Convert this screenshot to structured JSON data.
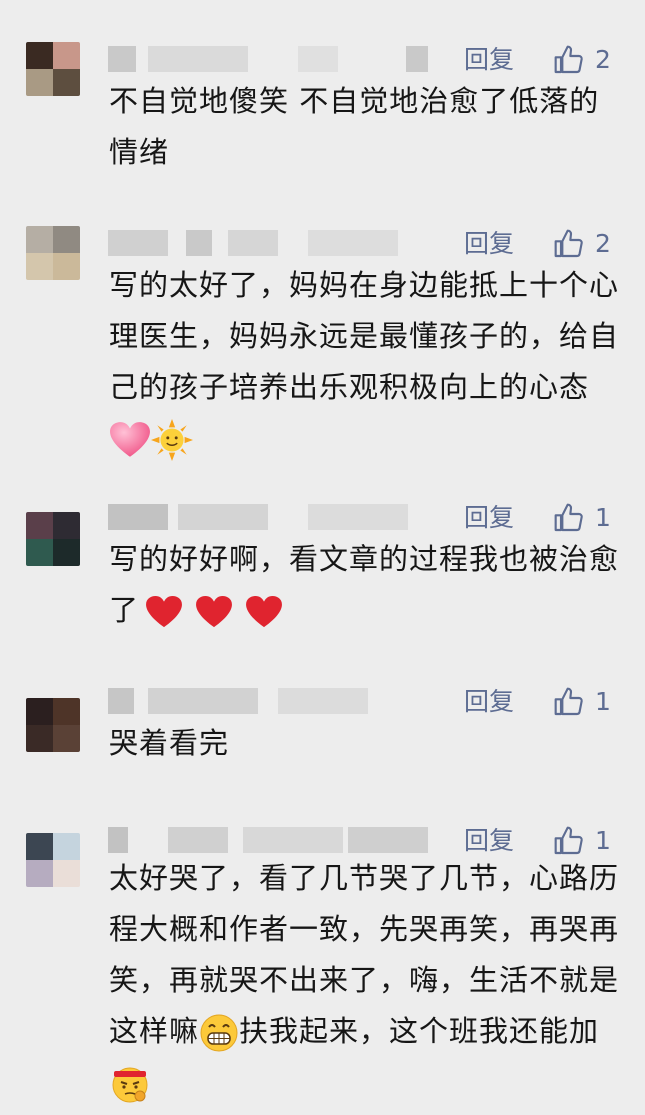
{
  "comments": [
    {
      "reply_label": "回复",
      "likes": "2",
      "text": "不自觉地傻笑 不自觉地治愈了低落的情绪",
      "avatar_colors": [
        "#3a2a22",
        "#c8978a",
        "#a99a84",
        "#5d4e3f"
      ]
    },
    {
      "reply_label": "回复",
      "likes": "2",
      "text": "写的太好了，妈妈在身边能抵上十个心理医生，妈妈永远是最懂孩子的，给自己的孩子培养出乐观积极向上的心态",
      "emoji": [
        "pink-heart-icon",
        "sun-face-icon"
      ],
      "avatar_colors": [
        "#b5aea4",
        "#908a82",
        "#d4c6ac",
        "#cbb99a"
      ]
    },
    {
      "reply_label": "回复",
      "likes": "1",
      "text": "写的好好啊，看文章的过程我也被治愈了",
      "emoji": [
        "red-heart-icon",
        "red-heart-icon",
        "red-heart-icon"
      ],
      "avatar_colors": [
        "#5a3f4a",
        "#2e2b33",
        "#2f5a4f",
        "#1d2a2a"
      ]
    },
    {
      "reply_label": "回复",
      "likes": "1",
      "text": "哭着看完",
      "avatar_colors": [
        "#2b1f1f",
        "#4e3428",
        "#3a2a26",
        "#5a4136"
      ]
    },
    {
      "reply_label": "回复",
      "likes": "1",
      "text_parts": [
        "太好哭了，看了几节哭了几节，心路历程大概和作者一致，先哭再笑，再哭再笑，再就哭不出来了，嗨，生活不就是这样嘛",
        "扶我起来，这个班我还能加"
      ],
      "emoji": [
        "grinning-face-icon",
        "angry-face-icon"
      ],
      "avatar_colors": [
        "#3c4652",
        "#c5d4de",
        "#b6acc0",
        "#eaded8"
      ]
    }
  ],
  "colors": {
    "background": "#ededed",
    "link": "#5d6c92",
    "text": "#161616"
  }
}
